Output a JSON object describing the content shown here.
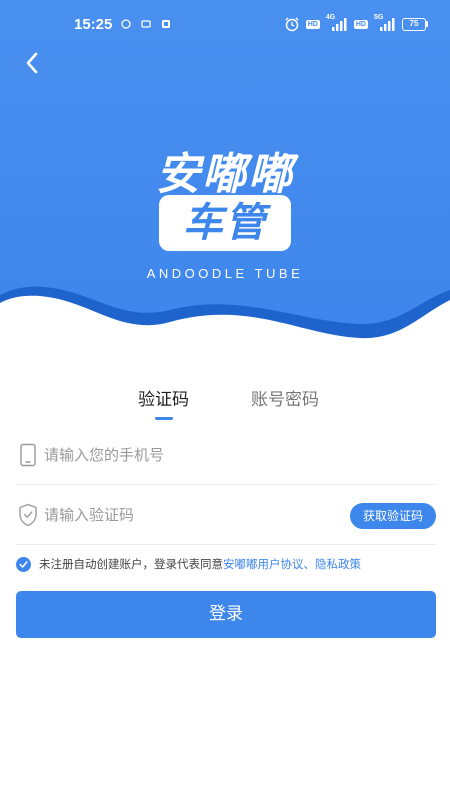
{
  "status_bar": {
    "time": "15:25",
    "hd_1": "HD",
    "net_1": "4G",
    "hd_2": "HD",
    "net_2": "5G",
    "battery": "75"
  },
  "brand": {
    "title": "安嘟嘟",
    "badge": "车管",
    "subtitle": "ANDOODLE TUBE",
    "primary_color": "#3d86ec"
  },
  "tabs": [
    {
      "label": "验证码",
      "active": true
    },
    {
      "label": "账号密码",
      "active": false
    }
  ],
  "form": {
    "phone_placeholder": "请输入您的手机号",
    "code_placeholder": "请输入验证码",
    "get_code_label": "获取验证码"
  },
  "agreement": {
    "checked": true,
    "prefix": "未注册自动创建账户，登录代表同意",
    "user_agreement": "安嘟嘟用户协议",
    "separator": "、",
    "privacy_policy": "隐私政策"
  },
  "login_label": "登录"
}
